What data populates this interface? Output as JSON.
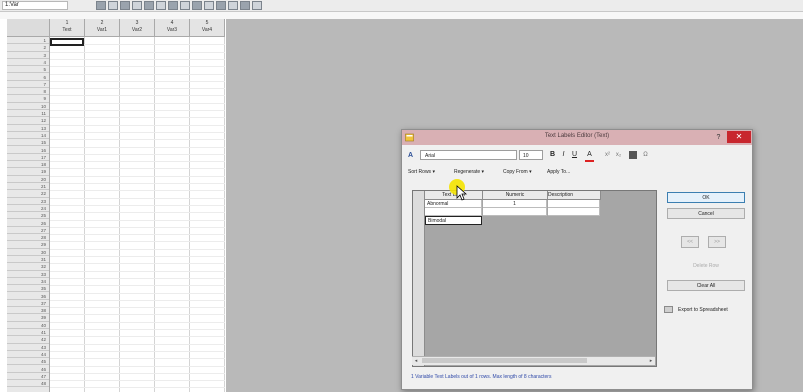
{
  "toolbar": {
    "name_box_value": "1:Var",
    "icons": [
      "new-icon",
      "open-icon",
      "save-icon",
      "print-icon",
      "cut-icon",
      "copy-icon",
      "paste-icon",
      "undo-icon",
      "redo-icon",
      "chart-icon",
      "table-icon",
      "graph-icon",
      "stats-icon",
      "settings-icon"
    ]
  },
  "spreadsheet": {
    "columns": [
      {
        "num": "1",
        "name": "Text"
      },
      {
        "num": "2",
        "name": "Var1"
      },
      {
        "num": "3",
        "name": "Var2"
      },
      {
        "num": "4",
        "name": "Var3"
      },
      {
        "num": "5",
        "name": "Var4"
      }
    ],
    "rows": [
      "1",
      "2",
      "3",
      "4",
      "5",
      "6",
      "7",
      "8",
      "9",
      "10",
      "11",
      "12",
      "13",
      "14",
      "15",
      "16",
      "17",
      "18",
      "19",
      "20",
      "21",
      "22",
      "23",
      "24",
      "25",
      "26",
      "27",
      "28",
      "29",
      "30",
      "31",
      "32",
      "33",
      "34",
      "35",
      "36",
      "37",
      "38",
      "39",
      "40",
      "41",
      "42",
      "43",
      "44",
      "45",
      "46",
      "47",
      "48"
    ]
  },
  "dialog": {
    "title": "Text Labels Editor (Text)",
    "help_label": "?",
    "close_label": "✕",
    "format": {
      "font_icon_label": "A",
      "font": "Arial",
      "size": "10",
      "bold": "B",
      "italic": "I",
      "underline": "U",
      "color_btn": "A",
      "extra_buttons": [
        "x²",
        "x₂",
        "Ω"
      ]
    },
    "menu": [
      "Sort Rows ▾",
      "Regenerate ▾",
      "Copy From ▾",
      "Apply To..."
    ],
    "table": {
      "headers": [
        "Text Label",
        "Numeric",
        "Description"
      ],
      "rows": [
        {
          "label": "Abnormal",
          "numeric": "1",
          "description": ""
        }
      ],
      "edit_value": "Bimodal"
    },
    "buttons": {
      "ok": "OK",
      "cancel": "Cancel",
      "up": "<<",
      "down": ">>",
      "delete_row": "Delete Row",
      "clear_all": "Clear All",
      "export": "Export to Spreadsheet"
    },
    "status": "1 Variable Text Labels out of 1 rows. Max length of 8 characters"
  },
  "colors": {
    "titlebar": "#d9b0b4",
    "close": "#c8262e",
    "status_text": "#2f49a8",
    "gray_area": "#b9b9b9"
  }
}
